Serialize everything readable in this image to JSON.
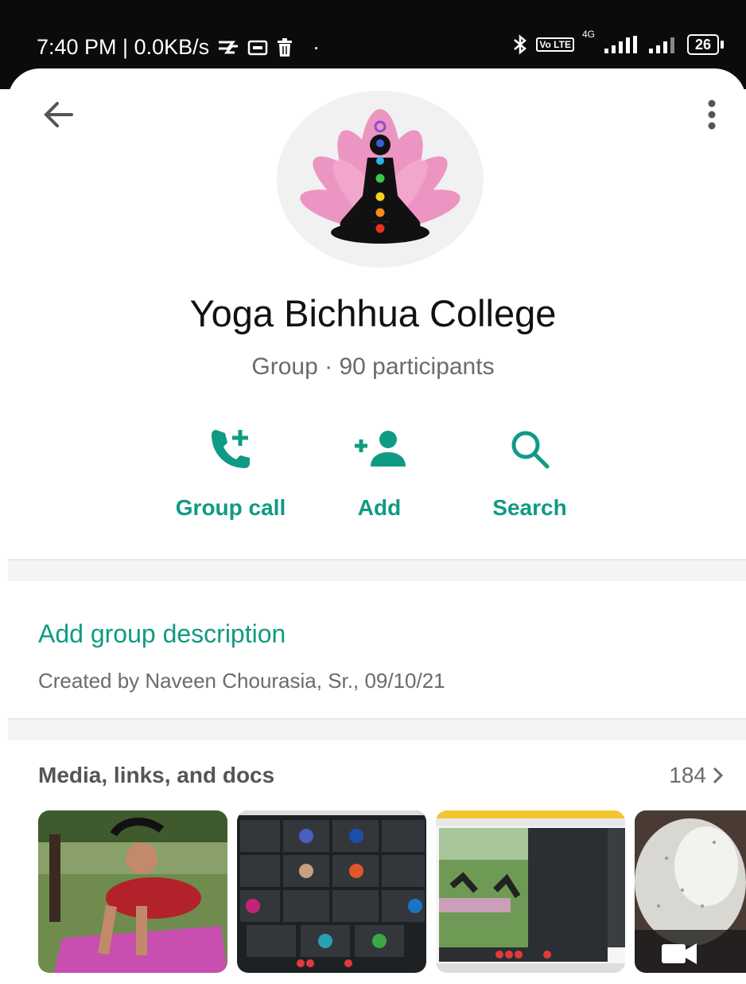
{
  "status_bar": {
    "time_speed": "7:40 PM | 0.0KB/s",
    "dot": "·",
    "lte_badge": "Vo LTE",
    "network": "4G",
    "battery": "26"
  },
  "header": {
    "back_icon": "arrow-left-icon",
    "more_icon": "more-vert-icon"
  },
  "group": {
    "name": "Yoga Bichhua College",
    "subtitle": "Group · 90 participants"
  },
  "actions": [
    {
      "label": "Group call",
      "icon": "call-add-icon"
    },
    {
      "label": "Add",
      "icon": "person-add-icon"
    },
    {
      "label": "Search",
      "icon": "search-icon"
    }
  ],
  "description": {
    "add_label": "Add group description",
    "created_by": "Created by Naveen Chourasia, Sr., 09/10/21"
  },
  "media": {
    "title": "Media, links, and docs",
    "count": "184",
    "thumbnail_names": [
      "yoga-pose-photo",
      "video-call-grid-screenshot",
      "outdoor-yoga-screenshot",
      "video-thumbnail"
    ]
  },
  "colors": {
    "accent": "#0f9b83",
    "status_bar": "#0b0b0b",
    "divider": "#f3f4f5"
  }
}
